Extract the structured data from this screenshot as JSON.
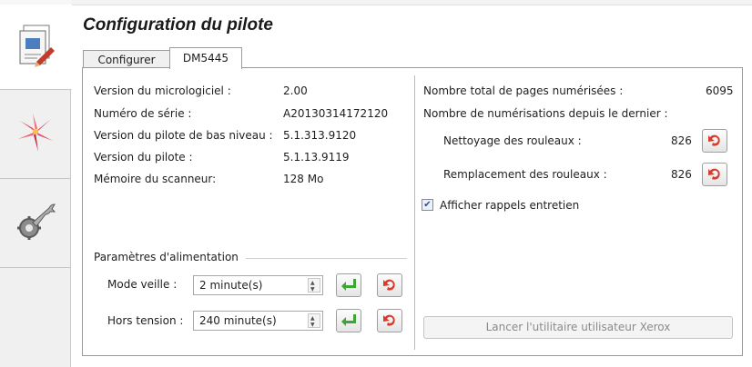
{
  "header": {
    "title": "Configuration du pilote"
  },
  "tabs": [
    {
      "label": "Configurer"
    },
    {
      "label": "DM5445"
    }
  ],
  "sidebar": {
    "items": [
      {
        "icon": "document-scan-icon"
      },
      {
        "icon": "lily-flower-icon"
      },
      {
        "icon": "wrench-gear-icon"
      }
    ]
  },
  "info": {
    "rows": [
      {
        "label": "Version du micrologiciel :",
        "value": "2.00"
      },
      {
        "label": "Numéro de série :",
        "value": "A20130314172120"
      },
      {
        "label": "Version du pilote de bas niveau :",
        "value": "5.1.313.9120"
      },
      {
        "label": "Version du pilote :",
        "value": "5.1.13.9119"
      },
      {
        "label": "Mémoire du scanneur:",
        "value": "128 Mo"
      }
    ]
  },
  "power": {
    "group_label": "Paramètres d'alimentation",
    "sleep_label": "Mode veille :",
    "sleep_value": "2 minute(s)",
    "off_label": "Hors tension :",
    "off_value": "240 minute(s)"
  },
  "stats": {
    "total_label": "Nombre total de pages numérisées :",
    "total_value": "6095",
    "since_label": "Nombre de numérisations depuis le dernier :",
    "cleaning_label": "Nettoyage des rouleaux :",
    "cleaning_value": "826",
    "replace_label": "Remplacement des rouleaux :",
    "replace_value": "826",
    "reminder_label": "Afficher rappels entretien",
    "reminder_checked": true
  },
  "launch_label": "Lancer l'utilitaire utilisateur Xerox",
  "colors": {
    "apply_green": "#3fa535",
    "reset_red": "#d93a2b",
    "panel_border": "#9a9a9a"
  }
}
